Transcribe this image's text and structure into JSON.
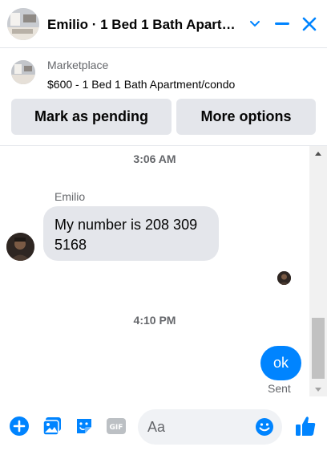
{
  "header": {
    "title": "Emilio · 1 Bed 1 Bath Apartment/condo",
    "icons": [
      "chevron-down-icon",
      "minimize-icon",
      "close-icon"
    ],
    "accent_color": "#0084ff"
  },
  "banner": {
    "source": "Marketplace",
    "listing": "$600 - 1 Bed 1 Bath Apartment/condo",
    "pending_button": "Mark as pending",
    "more_button": "More options"
  },
  "conversation": {
    "timestamp_1": "3:06 AM",
    "sender_name": "Emilio",
    "incoming_message": "My number is 208 309 5168",
    "timestamp_2": "4:10 PM",
    "outgoing_message": "ok",
    "status": "Sent",
    "outgoing_color": "#0084ff",
    "incoming_color": "#e4e6eb"
  },
  "composer": {
    "placeholder": "Aa",
    "icons": [
      "plus-icon",
      "photo-icon",
      "sticker-icon",
      "gif-icon",
      "emoji-icon",
      "thumbs-up-icon"
    ]
  }
}
